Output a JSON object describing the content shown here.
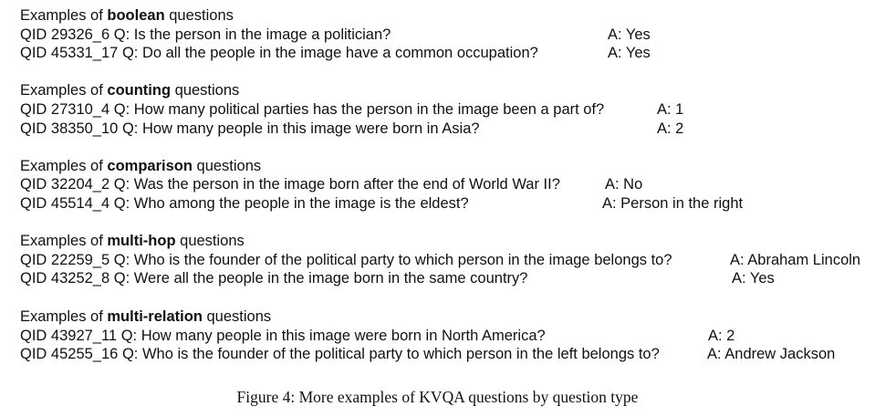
{
  "sections": [
    {
      "prefix": "Examples of",
      "type": "boolean",
      "suffix": "questions",
      "items": [
        {
          "qid": "QID 29326_6",
          "question": "Q: Is the person in the image a politician?",
          "answer": "A: Yes"
        },
        {
          "qid": "QID 45331_17",
          "question": "Q: Do all the people in the image have a common occupation?",
          "answer": "A: Yes"
        }
      ]
    },
    {
      "prefix": "Examples of",
      "type": "counting",
      "suffix": "questions",
      "items": [
        {
          "qid": "QID 27310_4",
          "question": "Q: How many political parties has the person in the image been a part of?",
          "answer": "A: 1"
        },
        {
          "qid": "QID 38350_10",
          "question": "Q: How many people in this image were born in Asia?",
          "answer": "A: 2"
        }
      ]
    },
    {
      "prefix": "Examples of",
      "type": "comparison",
      "suffix": "questions",
      "items": [
        {
          "qid": "QID 32204_2",
          "question": "Q: Was the person in the image born after the end of World War II?",
          "answer": "A: No"
        },
        {
          "qid": "QID 45514_4",
          "question": "Q: Who among the people in the image is the eldest?",
          "answer": "A: Person in the right"
        }
      ]
    },
    {
      "prefix": "Examples of",
      "type": "multi-hop",
      "suffix": "questions",
      "items": [
        {
          "qid": "QID 22259_5",
          "question": "Q: Who is the founder of the political party to which person in the image belongs to?",
          "answer": "A: Abraham Lincoln"
        },
        {
          "qid": "QID 43252_8",
          "question": "Q: Were all the people in the image born in the same country?",
          "answer": "A: Yes"
        }
      ]
    },
    {
      "prefix": "Examples of",
      "type": "multi-relation",
      "suffix": "questions",
      "items": [
        {
          "qid": "QID 43927_11",
          "question": "Q: How many people in this image were born in North America?",
          "answer": "A: 2"
        },
        {
          "qid": "QID 45255_16",
          "question": "Q: Who is the founder of the political party to which person in the left belongs to?",
          "answer": "A: Andrew Jackson"
        }
      ]
    }
  ],
  "caption": "Figure 4: More examples of KVQA questions by question type"
}
